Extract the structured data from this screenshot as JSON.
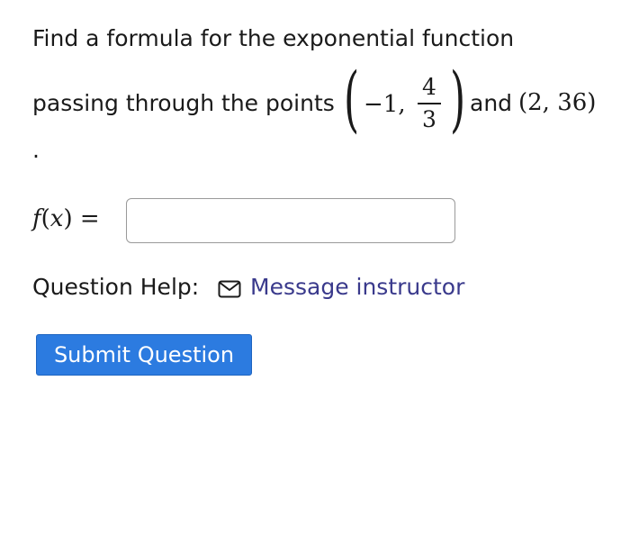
{
  "question": {
    "line1": "Find a formula for the exponential function",
    "line2_prefix": "passing through the points",
    "point1_x": "−1,",
    "point1_y_numerator": "4",
    "point1_y_denominator": "3",
    "conjunction": "and",
    "point2": "(2, 36)",
    "trailing_mark": "."
  },
  "answer": {
    "label_fn": "f",
    "label_var": "x",
    "equals": "=",
    "value": "",
    "placeholder": ""
  },
  "help": {
    "label": "Question Help:",
    "message_link": "Message instructor",
    "icon": "mail-icon"
  },
  "actions": {
    "submit_label": "Submit Question"
  },
  "colors": {
    "link": "#3a3a8c",
    "button": "#2c7be0",
    "button_text": "#ffffff",
    "input_border": "#9a9a9a"
  }
}
